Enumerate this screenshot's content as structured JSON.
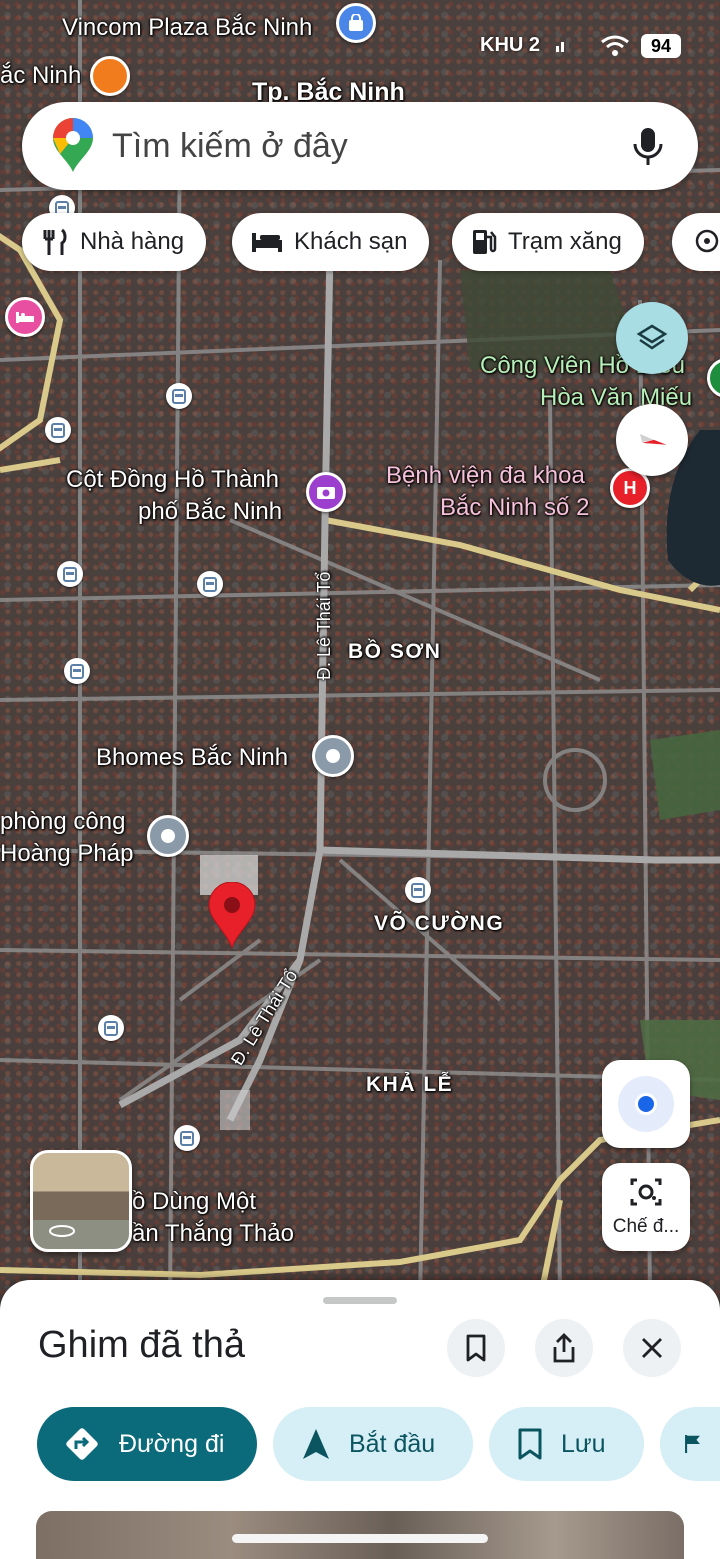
{
  "status_bar": {
    "carrier": "KHU 2",
    "battery": "94"
  },
  "search": {
    "placeholder": "Tìm kiếm ở đây",
    "logo_icon": "google-maps-pin-icon",
    "mic_icon": "mic-icon"
  },
  "chips": [
    {
      "label": "Nhà hàng",
      "icon": "restaurant-icon"
    },
    {
      "label": "Khách sạn",
      "icon": "hotel-icon"
    },
    {
      "label": "Trạm xăng",
      "icon": "gas-station-icon"
    }
  ],
  "map": {
    "labels": {
      "vincom": "Vincom Plaza Bắc Ninh",
      "bac_ninh_edge": "ắc Ninh",
      "city": "Tp. Bắc Ninh",
      "park_line1": "Công Viên Hồ Điều",
      "park_line2": "Hòa Văn Miếu",
      "monument_line1": "Cột Đồng Hồ Thành",
      "monument_line2": "phố Bắc Ninh",
      "hospital_line1": "Bệnh viện đa khoa",
      "hospital_line2": "Bắc Ninh số 2",
      "street_le_thai_to": "Đ. Lê Thái Tổ",
      "area_bo_son": "BỒ SƠN",
      "bhomes": "Bhomes Bắc Ninh",
      "office_line1": "phòng công",
      "office_line2": "Hoàng Pháp",
      "area_vo_cuong": "VÕ CƯỜNG",
      "area_kha_le": "KHẢ LỄ",
      "store_line1": "ồ Dùng Một",
      "store_line2": "ần Thắng Thảo"
    },
    "hospital_badge": "H",
    "layers_icon": "layers-icon",
    "compass_icon": "compass-icon",
    "my_location_icon": "my-location-icon",
    "lens_label": "Chế đ...",
    "lens_icon": "camera-lens-icon"
  },
  "sheet": {
    "title": "Ghim đã thả",
    "actions": [
      {
        "label": "Đường đi",
        "icon": "directions-icon"
      },
      {
        "label": "Bắt đầu",
        "icon": "navigation-arrow-icon"
      },
      {
        "label": "Lưu",
        "icon": "bookmark-icon"
      }
    ]
  },
  "colors": {
    "primary": "#0b6b7a",
    "secondary_bg": "#d6eef5",
    "pin_red": "#e8202a",
    "poi_purple": "#9c3fcf",
    "hotel_pink": "#e94fa0",
    "road_yellow": "#d9c98a"
  }
}
